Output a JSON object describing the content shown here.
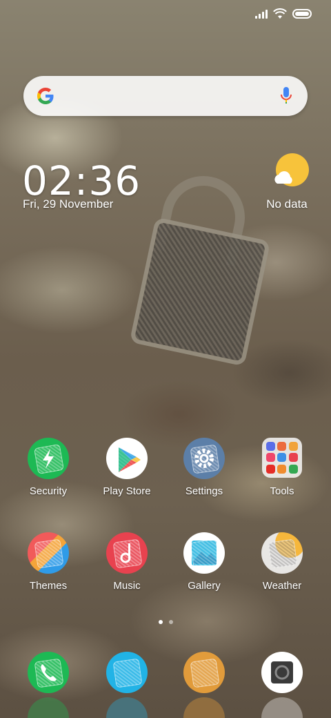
{
  "status_bar": {
    "signal_icon": "signal-bars-icon",
    "wifi_icon": "wifi-icon",
    "battery_icon": "battery-full-icon"
  },
  "search_bar": {
    "logo": "google-g-icon",
    "mic": "microphone-icon"
  },
  "clock_widget": {
    "time": "02:36",
    "date": "Fri, 29 November"
  },
  "weather_widget": {
    "icon": "sun-cloud-icon",
    "status": "No data"
  },
  "apps": [
    {
      "label": "Security",
      "icon": "security-lightning-icon",
      "color": "#1DB954"
    },
    {
      "label": "Play Store",
      "icon": "play-store-icon",
      "color": "#FFFFFF"
    },
    {
      "label": "Settings",
      "icon": "settings-gear-icon",
      "color": "#5C7FA8"
    },
    {
      "label": "Tools",
      "icon": "tools-folder-icon",
      "color": "#FFFFFF"
    },
    {
      "label": "Themes",
      "icon": "themes-icon",
      "color": "#F15A5A"
    },
    {
      "label": "Music",
      "icon": "music-note-icon",
      "color": "#E8424F"
    },
    {
      "label": "Gallery",
      "icon": "gallery-icon",
      "color": "#2CB7E0"
    },
    {
      "label": "Weather",
      "icon": "weather-app-icon",
      "color": "#F6B73C"
    }
  ],
  "pages": {
    "count": 2,
    "active": 0
  },
  "dock": [
    {
      "icon": "phone-icon",
      "color": "#1DB954"
    },
    {
      "icon": "messages-icon",
      "color": "#21B3E6"
    },
    {
      "icon": "browser-icon",
      "color": "#F0A33A"
    },
    {
      "icon": "camera-icon",
      "color": "#FFFFFF"
    }
  ]
}
